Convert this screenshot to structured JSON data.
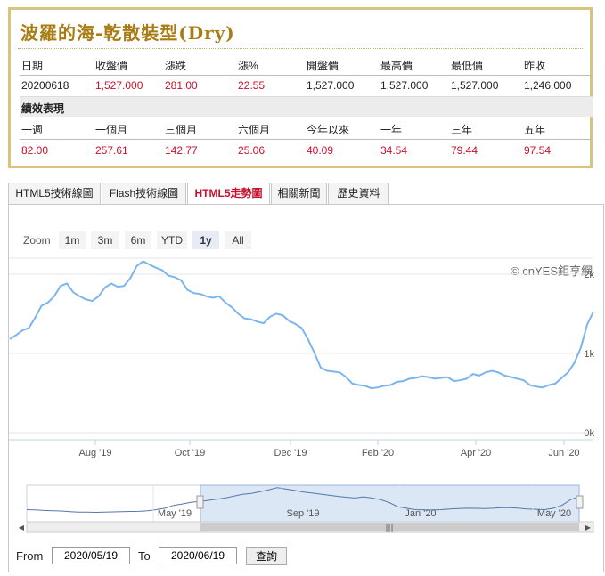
{
  "fund": {
    "title": "波羅的海-乾散裝型(Dry)",
    "quote_headers": [
      "日期",
      "收盤價",
      "漲跌",
      "漲%",
      "開盤價",
      "最高價",
      "最低價",
      "昨收"
    ],
    "quote_values": [
      "20200618",
      "1,527.000",
      "281.00",
      "22.55",
      "1,527.000",
      "1,527.000",
      "1,527.000",
      "1,246.000"
    ],
    "performance_label": "績效表現",
    "performance_headers": [
      "一週",
      "一個月",
      "三個月",
      "六個月",
      "今年以來",
      "一年",
      "三年",
      "五年"
    ],
    "performance_values": [
      "82.00",
      "257.61",
      "142.77",
      "25.06",
      "40.09",
      "34.54",
      "79.44",
      "97.54"
    ]
  },
  "tabs": [
    {
      "label": "HTML5技術線圖",
      "active": false
    },
    {
      "label": "Flash技術線圖",
      "active": false
    },
    {
      "label": "HTML5走勢圖",
      "active": true
    },
    {
      "label": "相關新聞",
      "active": false
    },
    {
      "label": "歷史資料",
      "active": false
    }
  ],
  "zoom": {
    "label": "Zoom",
    "buttons": [
      "1m",
      "3m",
      "6m",
      "YTD",
      "1y",
      "All"
    ],
    "selected": "1y"
  },
  "credit": "© cnYES鉅亨網",
  "range": {
    "from_label": "From",
    "from_value": "2020/05/19",
    "to_label": "To",
    "to_value": "2020/06/19",
    "submit_label": "查詢"
  },
  "colors": {
    "line": "#7cb5ec",
    "accent_red": "#c8102e",
    "title_gold": "#a87c12",
    "border_gold": "#d7c47f",
    "nav_fill": "#d6e3f4"
  },
  "chart_data": {
    "type": "line",
    "x_ticks": [
      "Aug '19",
      "Oct '19",
      "Dec '19",
      "Feb '20",
      "Apr '20",
      "Jun '20"
    ],
    "y_ticks": [
      "0k",
      "1k",
      "2k"
    ],
    "ylim": [
      0,
      2200
    ],
    "series": [
      {
        "values": [
          1180,
          1230,
          1290,
          1320,
          1450,
          1600,
          1640,
          1720,
          1850,
          1880,
          1770,
          1720,
          1680,
          1660,
          1720,
          1830,
          1880,
          1840,
          1850,
          1950,
          2100,
          2160,
          2120,
          2080,
          2050,
          1980,
          1960,
          1920,
          1800,
          1760,
          1750,
          1720,
          1700,
          1720,
          1640,
          1580,
          1500,
          1440,
          1430,
          1400,
          1380,
          1460,
          1500,
          1480,
          1410,
          1370,
          1320,
          1180,
          1010,
          820,
          780,
          770,
          760,
          700,
          620,
          600,
          590,
          560,
          570,
          590,
          600,
          640,
          650,
          680,
          690,
          710,
          700,
          680,
          690,
          700,
          650,
          660,
          680,
          740,
          720,
          760,
          780,
          760,
          720,
          700,
          680,
          660,
          600,
          580,
          570,
          600,
          620,
          690,
          760,
          880,
          1070,
          1360,
          1527
        ]
      }
    ],
    "navigator": {
      "x_ticks": [
        "May '19",
        "Sep '19",
        "Jan '20",
        "May '20"
      ],
      "values": [
        600,
        580,
        540,
        520,
        500,
        460,
        430,
        420,
        410,
        420,
        440,
        460,
        470,
        480,
        520,
        600,
        700,
        900,
        1000,
        1120,
        1180,
        1250,
        1330,
        1420,
        1550,
        1680,
        1740,
        1860,
        2000,
        2150,
        2060,
        1960,
        1850,
        1780,
        1700,
        1620,
        1540,
        1480,
        1420,
        1500,
        1420,
        1300,
        1100,
        800,
        700,
        600,
        580,
        570,
        600,
        650,
        680,
        700,
        690,
        680,
        700,
        740,
        740,
        700,
        640,
        620,
        600,
        700,
        900,
        1300,
        1527
      ]
    }
  }
}
